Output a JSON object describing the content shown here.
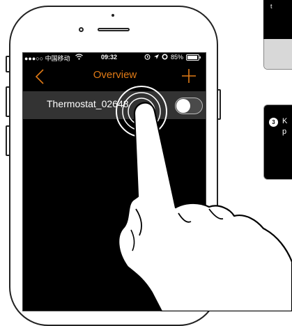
{
  "status_bar": {
    "carrier": "●●●○○ 中国移动",
    "time": "09:32",
    "battery": "85%"
  },
  "nav": {
    "title": "Overview"
  },
  "devices": [
    {
      "name": "Thermostat_02648",
      "on": false
    }
  ],
  "side_cards": {
    "top_text": "t",
    "step_number": "3",
    "step_text_lines": [
      "K",
      "p"
    ]
  },
  "colors": {
    "accent": "#e07a16",
    "row_bg": "#333333"
  }
}
